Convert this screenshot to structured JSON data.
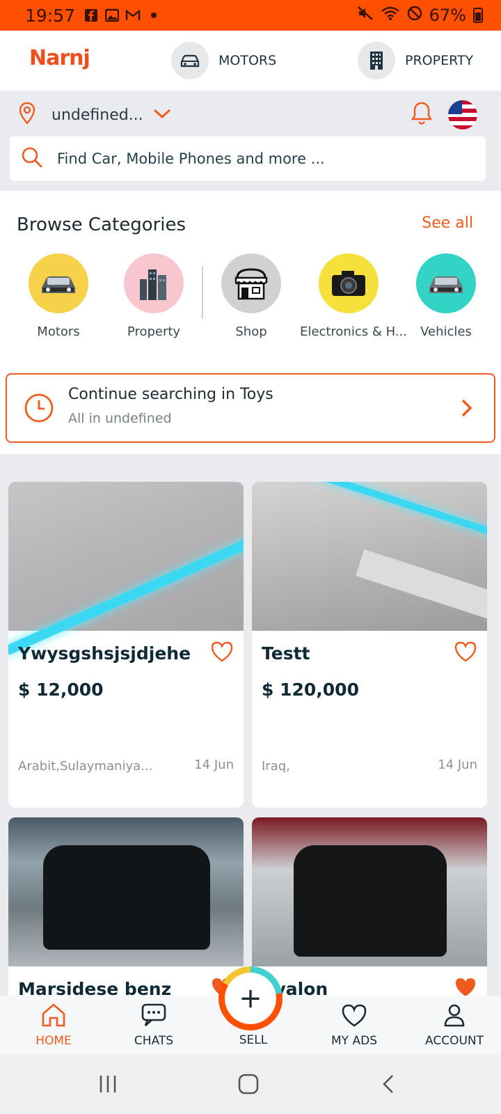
{
  "status_bar": {
    "time": "19:57",
    "battery": "67%",
    "left_icons": [
      "facebook-icon",
      "gallery-icon",
      "gmail-icon",
      "dot-icon"
    ],
    "right_icons": [
      "mute-icon",
      "wifi-icon",
      "block-icon",
      "battery-icon"
    ]
  },
  "header": {
    "logo": "Narnj",
    "nav": [
      {
        "label": "MOTORS",
        "icon": "car-icon"
      },
      {
        "label": "PROPERTY",
        "icon": "building-icon"
      }
    ]
  },
  "location": {
    "value": "undefined...",
    "icon": "location-pin-icon"
  },
  "search": {
    "placeholder": "Find Car, Mobile Phones and more ..."
  },
  "categories": {
    "title": "Browse Categories",
    "see_all": "See all",
    "items": [
      {
        "label": "Motors",
        "bg": "#f5d24a"
      },
      {
        "label": "Property",
        "bg": "#f7c6cf"
      },
      {
        "label": "Shop",
        "bg": "#cfd1d3"
      },
      {
        "label": "Electronics & H...",
        "bg": "#f5e03c"
      },
      {
        "label": "Vehicles",
        "bg": "#33d3c6"
      }
    ]
  },
  "continue": {
    "line1": "Continue searching in  Toys",
    "line2": "All in undefined"
  },
  "listings": [
    {
      "title": "Ywysgshsjsjdjehe",
      "price": "$ 12,000",
      "location": "Arabit,Sulaymaniya...",
      "date": "14 Jun",
      "favorited": false
    },
    {
      "title": "Testt",
      "price": "$ 120,000",
      "location": "Iraq,",
      "date": "14 Jun",
      "favorited": false
    },
    {
      "title": "Marsidese benz",
      "favorited": true
    },
    {
      "title": "Avalon",
      "favorited": true
    }
  ],
  "bottom_nav": {
    "home": "HOME",
    "chats": "CHATS",
    "sell": "SELL",
    "my_ads": "MY ADS",
    "account": "ACCOUNT"
  },
  "colors": {
    "accent": "#ef5a1f",
    "status_bar": "#ff4f00",
    "text_dark": "#0e2a34"
  }
}
